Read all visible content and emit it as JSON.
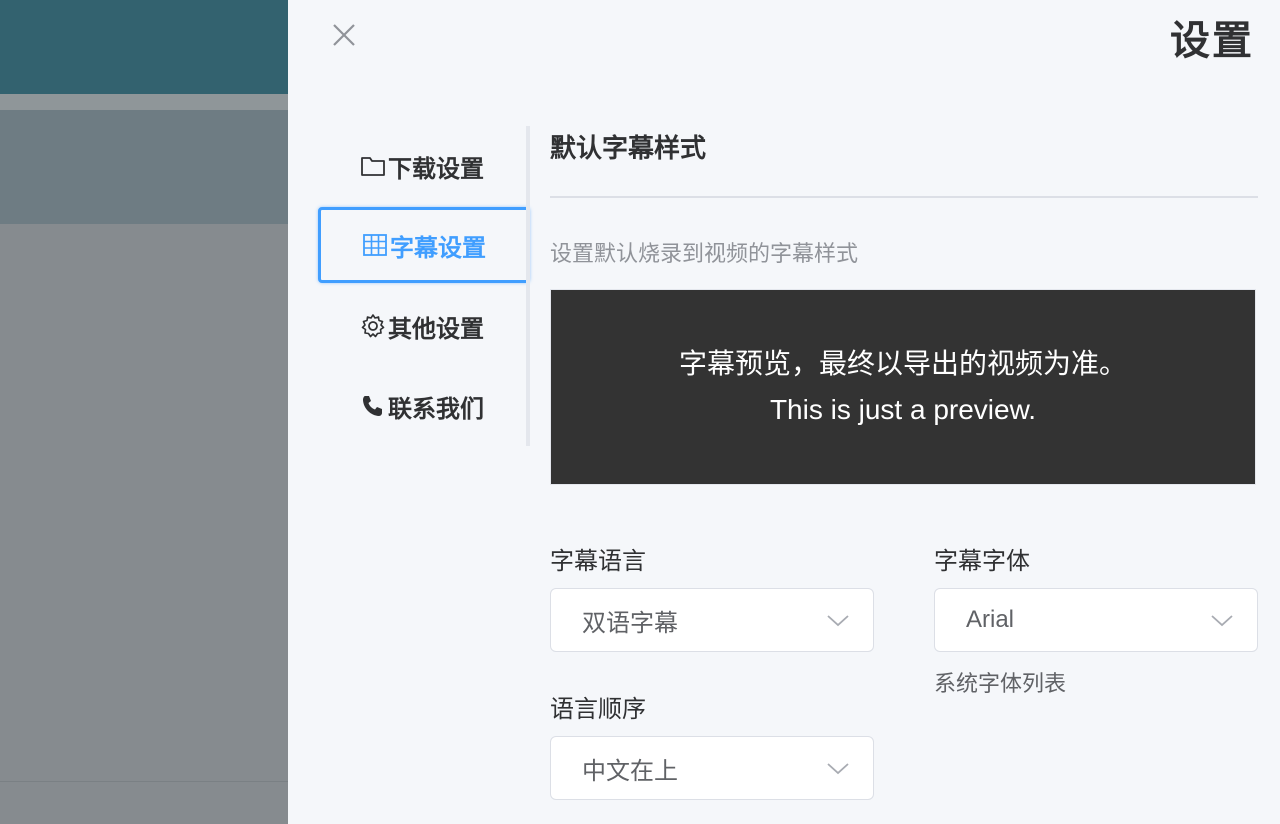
{
  "drawer": {
    "title": "设置"
  },
  "menu": {
    "items": [
      {
        "label": "下载设置",
        "icon": "folder-icon"
      },
      {
        "label": "字幕设置",
        "icon": "grid-icon",
        "active": true
      },
      {
        "label": "其他设置",
        "icon": "gear-icon"
      },
      {
        "label": "联系我们",
        "icon": "phone-icon"
      }
    ]
  },
  "subtitle_section": {
    "title": "默认字幕样式",
    "description": "设置默认烧录到视频的字幕样式",
    "preview": {
      "line1": "字幕预览，最终以导出的视频为准。",
      "line2": "This is just a preview."
    },
    "language": {
      "label": "字幕语言",
      "value": "双语字幕"
    },
    "order": {
      "label": "语言顺序",
      "value": "中文在上"
    },
    "font": {
      "label": "字幕字体",
      "value": "Arial",
      "hint": "系统字体列表"
    }
  },
  "colors": {
    "accent": "#409eff",
    "text": "#303133",
    "muted": "#909399",
    "preview_bg": "#333333"
  }
}
